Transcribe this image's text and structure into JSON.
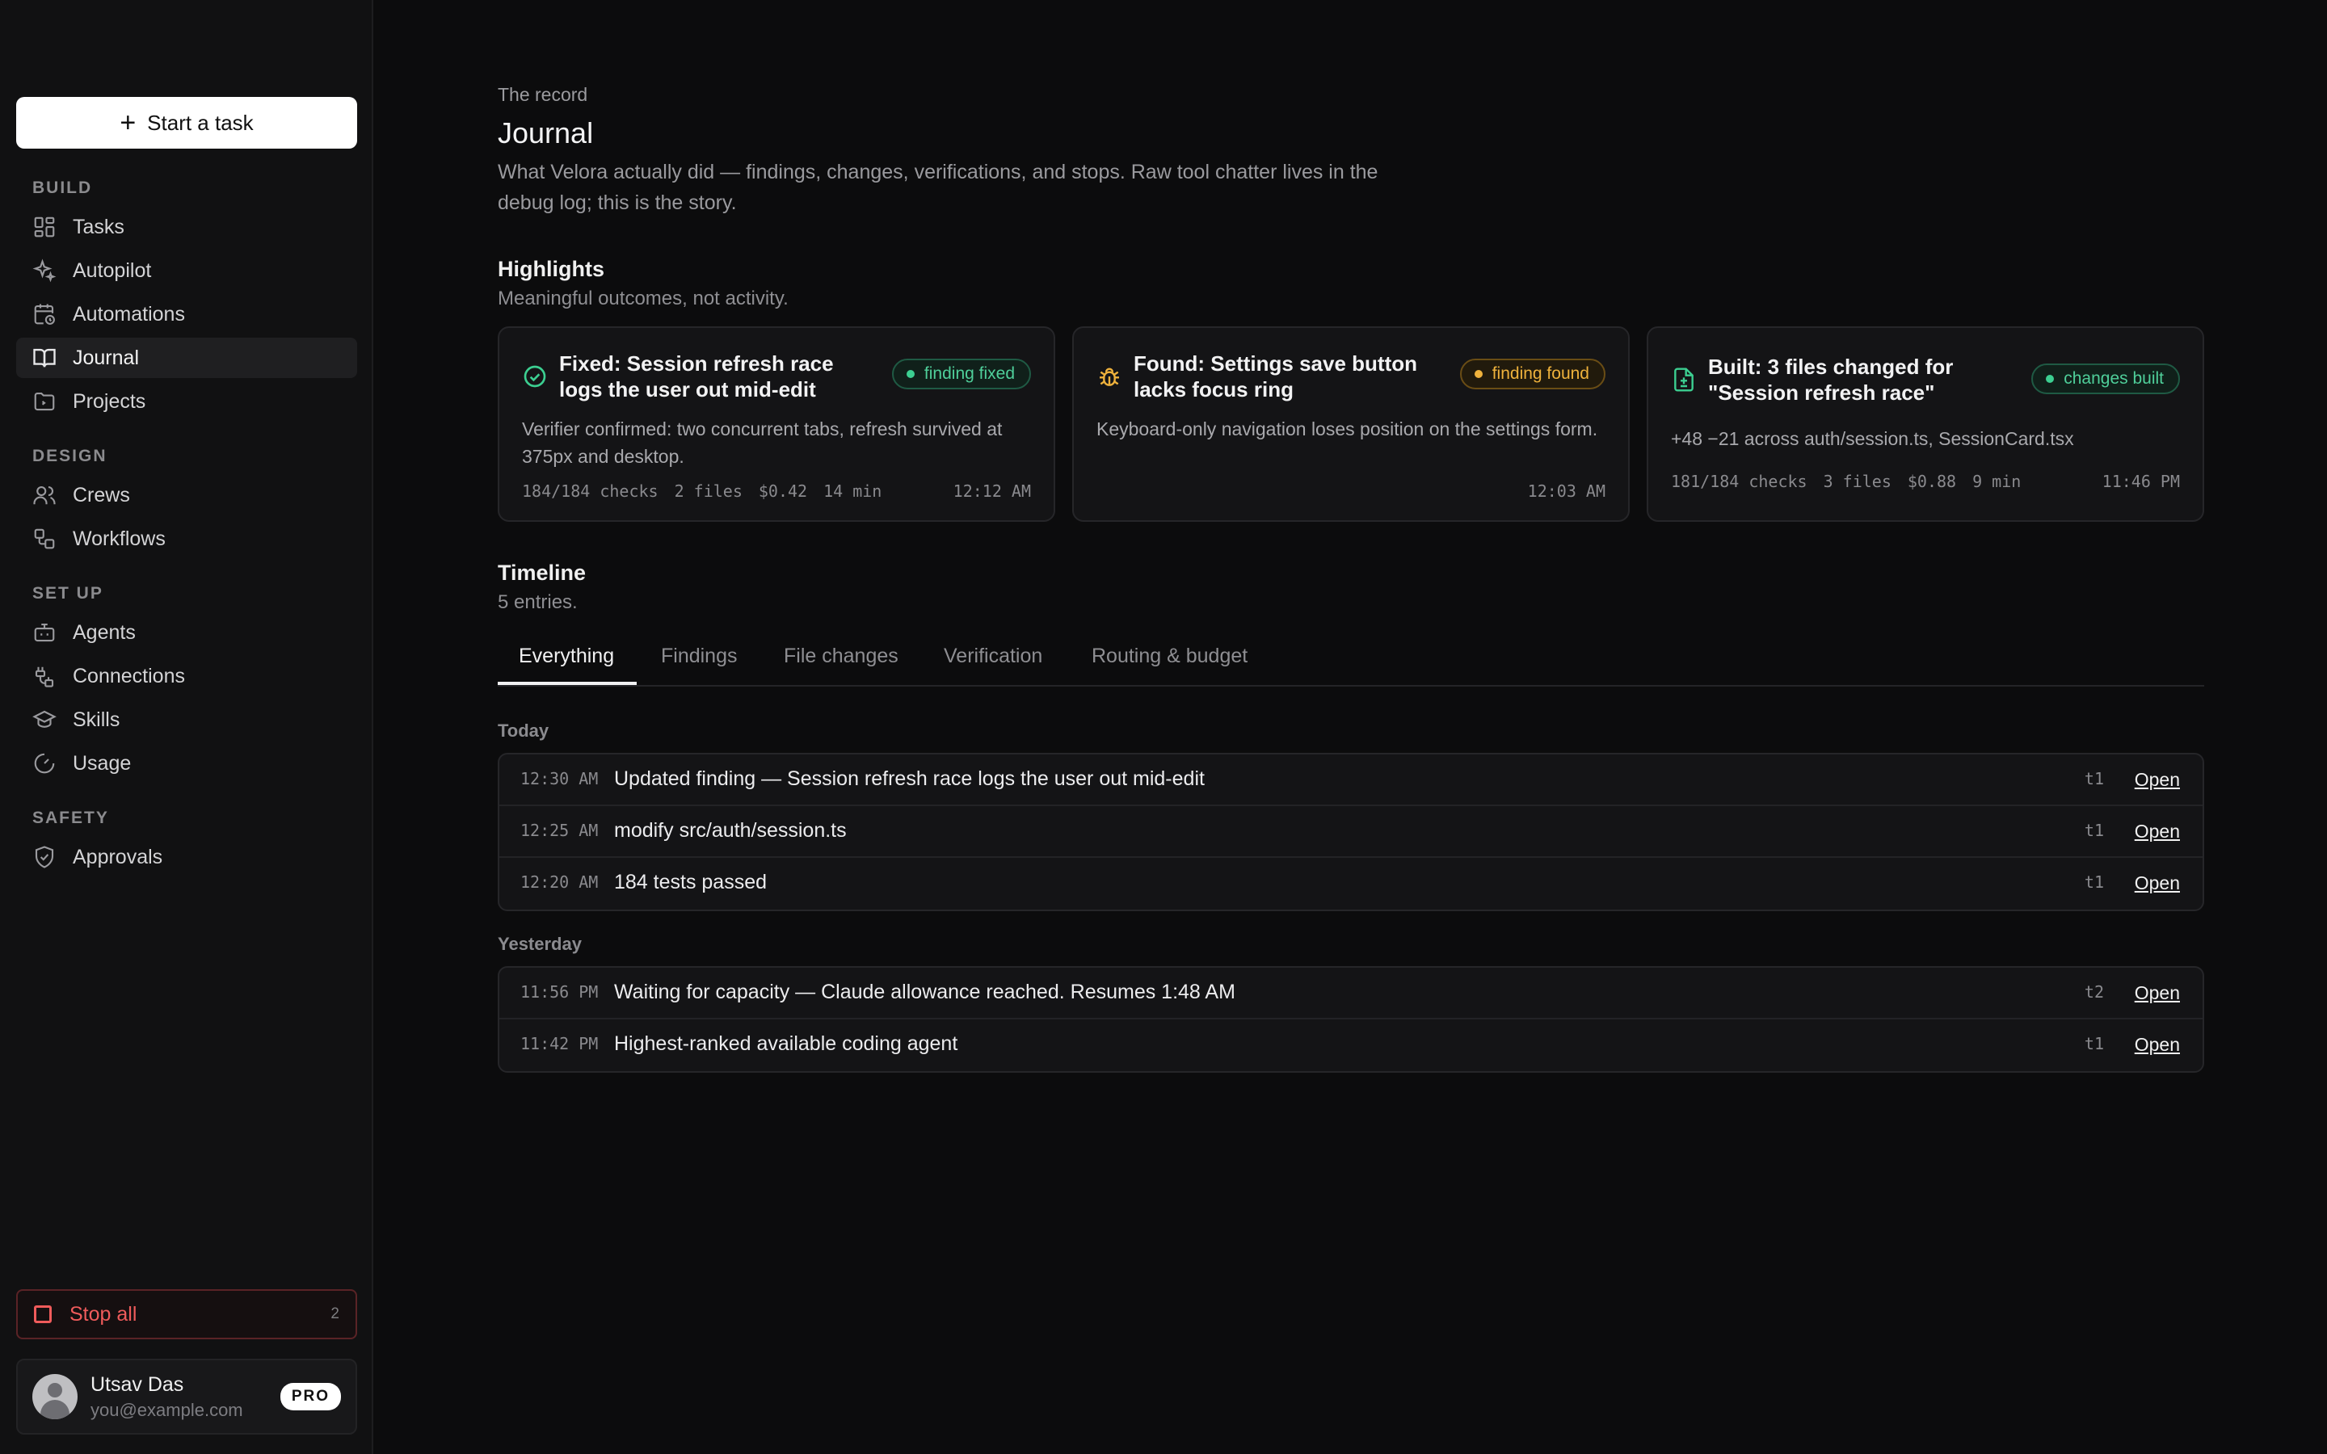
{
  "sidebar": {
    "start_task": "Start a task",
    "sections": {
      "build": "BUILD",
      "design": "DESIGN",
      "setup": "SET UP",
      "safety": "SAFETY"
    },
    "items": {
      "tasks": "Tasks",
      "autopilot": "Autopilot",
      "automations": "Automations",
      "journal": "Journal",
      "projects": "Projects",
      "crews": "Crews",
      "workflows": "Workflows",
      "agents": "Agents",
      "connections": "Connections",
      "skills": "Skills",
      "usage": "Usage",
      "approvals": "Approvals"
    },
    "stop_all": {
      "label": "Stop all",
      "count": "2"
    },
    "user": {
      "name": "Utsav Das",
      "email": "you@example.com",
      "plan": "PRO"
    }
  },
  "header": {
    "eyebrow": "The record",
    "title": "Journal",
    "description": "What Velora actually did — findings, changes, verifications, and stops. Raw tool chatter lives in the debug log; this is the story."
  },
  "highlights": {
    "title": "Highlights",
    "subtitle": "Meaningful outcomes, not activity.",
    "cards": [
      {
        "title": "Fixed: Session refresh race logs the user out mid-edit",
        "badge": "finding fixed",
        "body": "Verifier confirmed: two concurrent tabs, refresh survived at 375px and desktop.",
        "checks": "184/184 checks",
        "files": "2 files",
        "cost": "$0.42",
        "duration": "14 min",
        "time": "12:12 AM"
      },
      {
        "title": "Found: Settings save button lacks focus ring",
        "badge": "finding found",
        "body": "Keyboard-only navigation loses position on the settings form.",
        "time": "12:03 AM"
      },
      {
        "title": "Built: 3 files changed for \"Session refresh race\"",
        "badge": "changes built",
        "body": "+48 −21 across auth/session.ts, SessionCard.tsx",
        "checks": "181/184 checks",
        "files": "3 files",
        "cost": "$0.88",
        "duration": "9 min",
        "time": "11:46 PM"
      }
    ]
  },
  "timeline": {
    "title": "Timeline",
    "count": "5 entries.",
    "tabs": [
      "Everything",
      "Findings",
      "File changes",
      "Verification",
      "Routing & budget"
    ],
    "open_label": "Open",
    "groups": [
      {
        "label": "Today",
        "rows": [
          {
            "time": "12:30 AM",
            "text": "Updated finding — Session refresh race logs the user out mid-edit",
            "tag": "t1"
          },
          {
            "time": "12:25 AM",
            "text": "modify src/auth/session.ts",
            "tag": "t1"
          },
          {
            "time": "12:20 AM",
            "text": "184 tests passed",
            "tag": "t1"
          }
        ]
      },
      {
        "label": "Yesterday",
        "rows": [
          {
            "time": "11:56 PM",
            "text": "Waiting for capacity — Claude allowance reached. Resumes 1:48 AM",
            "tag": "t2"
          },
          {
            "time": "11:42 PM",
            "text": "Highest-ranked available coding agent",
            "tag": "t1"
          }
        ]
      }
    ]
  },
  "colors": {
    "accent_green": "#3ccf91",
    "accent_amber": "#efb23c",
    "danger": "#ef5b5b"
  }
}
